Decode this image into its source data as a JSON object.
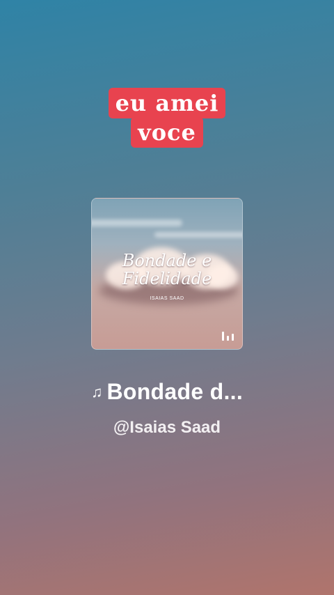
{
  "caption": {
    "line1": "eu amei",
    "line2": "voce",
    "highlight_color": "#e8434f"
  },
  "album": {
    "cover_title_line1": "Bondade e",
    "cover_title_line2": "Fidelidade",
    "cover_artist": "ISAIAS SAAD",
    "equalizer_icon": "equalizer-icon"
  },
  "track": {
    "note_icon": "♫",
    "title": "Bondade d...",
    "artist_handle": "@Isaias Saad"
  }
}
